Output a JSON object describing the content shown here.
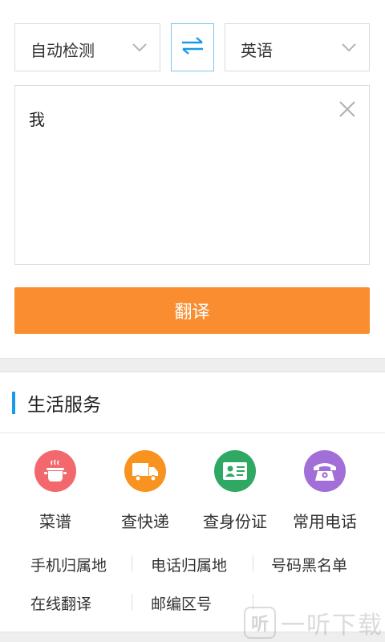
{
  "translator": {
    "source_lang": "自动检测",
    "target_lang": "英语",
    "input_text": "我",
    "translate_button": "翻译"
  },
  "life_services": {
    "title": "生活服务",
    "services": [
      {
        "label": "菜谱",
        "icon": "cooking-pot-icon",
        "color": "#f2686c"
      },
      {
        "label": "查快递",
        "icon": "delivery-truck-icon",
        "color": "#f7931e"
      },
      {
        "label": "查身份证",
        "icon": "id-card-icon",
        "color": "#2ea862"
      },
      {
        "label": "常用电话",
        "icon": "telephone-icon",
        "color": "#a26fd8"
      }
    ],
    "links": [
      "手机归属地",
      "电话归属地",
      "号码黑名单",
      "在线翻译",
      "邮编区号"
    ]
  },
  "watermark": {
    "glyph": "听",
    "text": "一听下载"
  },
  "colors": {
    "accent_orange": "#f98d2f",
    "accent_blue": "#1a9ae8"
  }
}
